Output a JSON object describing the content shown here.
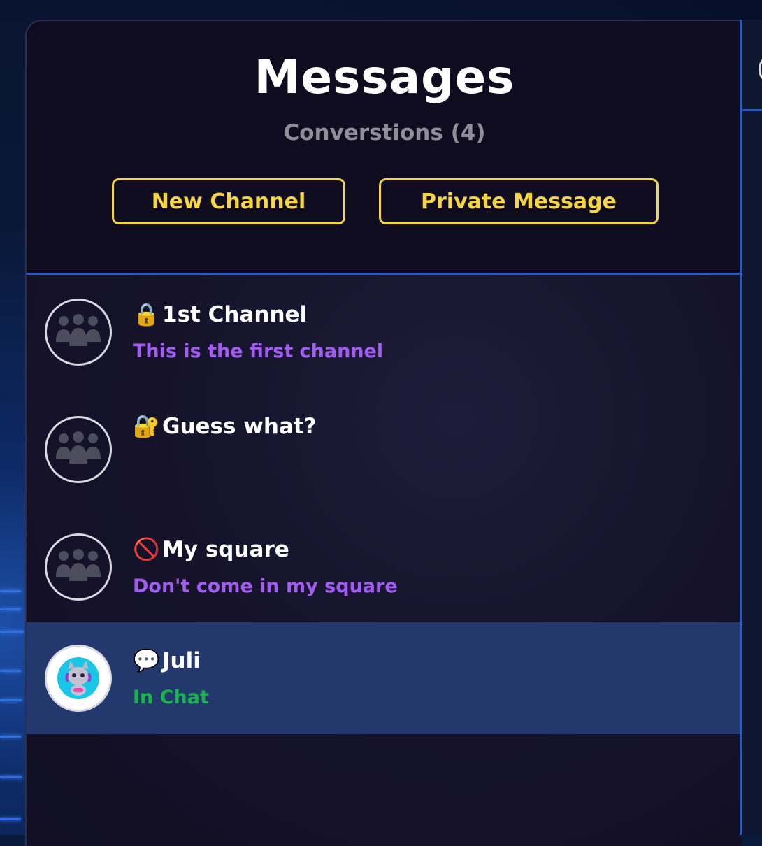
{
  "header": {
    "title": "Messages",
    "subtitle": "Converstions (4)",
    "new_channel_label": "New Channel",
    "private_message_label": "Private Message"
  },
  "conversations": [
    {
      "icon": "lock-icon",
      "glyph": "🔒",
      "name": "1st Channel",
      "subtitle": "This is the first channel",
      "subtitle_color": "#a35cf2",
      "avatar": "group-icon"
    },
    {
      "icon": "lock-with-key-icon",
      "glyph": "🔐",
      "name": "Guess what?",
      "subtitle": "",
      "subtitle_color": "#a35cf2",
      "avatar": "group-icon"
    },
    {
      "icon": "prohibited-icon",
      "glyph": "🚫",
      "name": "My square",
      "subtitle": "Don't come in my square",
      "subtitle_color": "#a35cf2",
      "avatar": "group-icon"
    },
    {
      "icon": "speech-bubble-icon",
      "glyph": "💬",
      "name": "Juli",
      "subtitle": "In Chat",
      "subtitle_color": "#18b54a",
      "avatar": "cat-avatar-icon",
      "selected": true
    }
  ],
  "colors": {
    "accent": "#f5d541",
    "divider": "#2d5bb5",
    "selected_row": "#23396e"
  }
}
